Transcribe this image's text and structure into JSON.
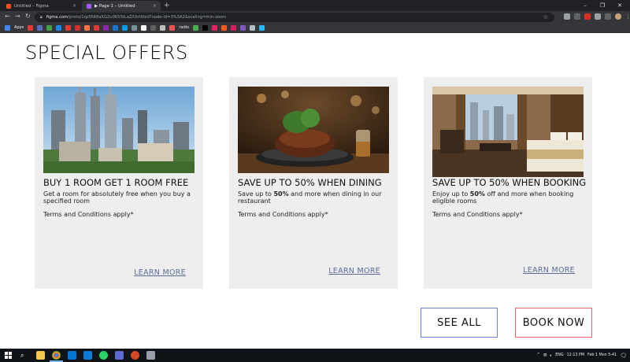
{
  "browser": {
    "tabs": [
      {
        "label": "Untitled – Figma",
        "active": false,
        "favicon_color": "#f24e1e"
      },
      {
        "label": "▶ Page 1 – Untitled",
        "active": true,
        "favicon_color": "#a259ff"
      }
    ],
    "new_tab_glyph": "+",
    "close_glyph": "×",
    "window_controls": {
      "minimize": "–",
      "restore": "❐",
      "close": "✕"
    },
    "nav": {
      "back": "←",
      "forward": "→",
      "reload": "↻"
    },
    "url": {
      "host": "figma.com",
      "path": "/proto/1qz5Nt8aXG2u0K55tLaZ/Untitled?node-id=3%3A2&scaling=min-zoom"
    },
    "bookmarks": {
      "apps_label": "Apps",
      "radio_label": "radio",
      "icon_colors": [
        "#e53935",
        "#5c6bc0",
        "#43a047",
        "#1e88e5",
        "#e53935",
        "#d32f2f",
        "#ff7043",
        "#e53935",
        "#8e24aa",
        "#1976d2",
        "#039be5",
        "#78909c",
        "#ffffff",
        "#616161",
        "#bdbdbd",
        "#ef5350",
        "#4caf50",
        "#000000",
        "#e91e63",
        "#ff5722",
        "#d81b60",
        "#7e57c2",
        "#b0bec5",
        "#29b6f6"
      ]
    }
  },
  "page": {
    "heading": "SPECIAL OFFERS",
    "offers": [
      {
        "photo": "city-skyline-photo",
        "title": "BUY 1 ROOM GET 1 ROOM FREE",
        "description": "Get a room for absolutely free when you buy a specified room",
        "terms": "Terms and Conditions apply*",
        "link": "LEARN MORE"
      },
      {
        "photo": "steak-dinner-photo",
        "title": "SAVE UP TO 50%  WHEN DINING",
        "description_prefix": "Save up to ",
        "description_highlight": "50%",
        "description_suffix": " and more when dining in our restaurant",
        "terms": "Terms and Conditions apply*",
        "link": "LEARN MORE"
      },
      {
        "photo": "hotel-room-photo",
        "title": "SAVE UP TO 50% WHEN BOOKING",
        "description_prefix": "Enjoy up to ",
        "description_highlight": "50%",
        "description_suffix": " off and more when booking eligible rooms",
        "terms": "Terms and Conditions apply*",
        "link": "LEARN MORE"
      }
    ],
    "buttons": {
      "see_all": "SEE ALL",
      "book_now": "BOOK NOW"
    },
    "colors": {
      "card_bg": "#eeeeee",
      "link": "#5b6b9a",
      "see_all_border": "#6c7fd6",
      "book_now_border": "#e0666b"
    }
  },
  "taskbar": {
    "language": "ENG",
    "time": "12:13 PM",
    "date": "Feb 1 Mon 5-41"
  }
}
